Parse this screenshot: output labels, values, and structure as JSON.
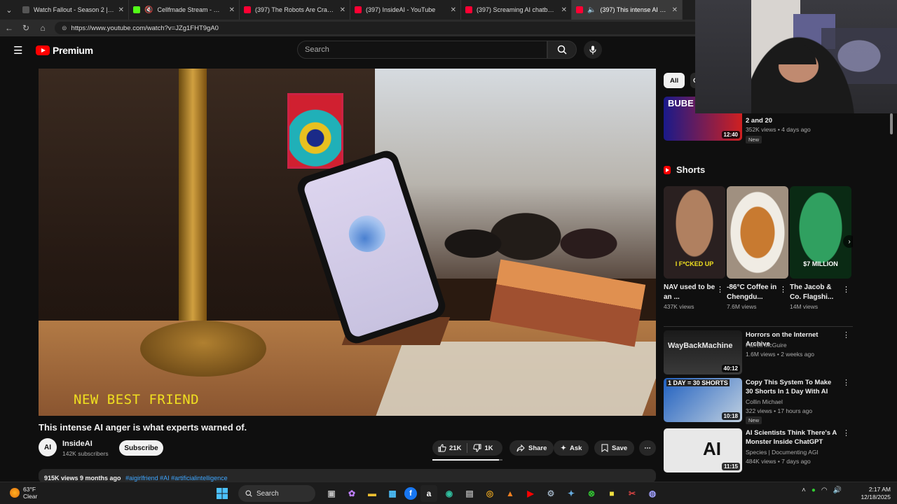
{
  "browser": {
    "tabs": [
      {
        "title": "Watch Fallout - Season 2 | Prime V",
        "fav_color": "#555555"
      },
      {
        "title": "Cellfmade Stream - Watch Liv",
        "fav_color": "#53fc18"
      },
      {
        "title": "(397) The Robots Are Crashing Ou",
        "fav_color": "#ff0033"
      },
      {
        "title": "(397) InsideAI - YouTube",
        "fav_color": "#ff0033"
      },
      {
        "title": "(397) Screaming AI chatbot claim",
        "fav_color": "#ff0033"
      },
      {
        "title": "(397) This intense AI anger is",
        "fav_color": "#ff0033"
      }
    ],
    "url": "https://www.youtube.com/watch?v=JZg1FHT9gA0"
  },
  "header": {
    "logo_text": "Premium",
    "search_placeholder": "Search"
  },
  "video": {
    "caption": "NEW BEST FRIEND",
    "title": "This intense AI anger is what experts warned of.",
    "channel": {
      "avatar": "AI",
      "name": "InsideAI",
      "subscribers": "142K subscribers"
    },
    "subscribe_label": "Subscribe",
    "likes": "21K",
    "dislikes": "1K",
    "like_ratio": 0.95,
    "share_label": "Share",
    "ask_label": "Ask",
    "save_label": "Save",
    "description": {
      "meta": "915K views  9 months ago",
      "tags": "#aigirlfriend #AI #artificialintelligence"
    }
  },
  "sidebar": {
    "chips": [
      "All",
      "C"
    ],
    "top_rec": {
      "thumb_text": "BUBE",
      "duration": "12:40",
      "title_tail": "2 and 20",
      "meta": "352K views • 4 days ago",
      "badge": "New"
    },
    "shorts_heading": "Shorts",
    "shorts": [
      {
        "title": "NAV used to be an ...",
        "views": "437K views",
        "overlay": "I F*CKED UP",
        "bg": "#3a2a20"
      },
      {
        "title": "-86°C Coffee in Chengdu...",
        "views": "7.6M views",
        "overlay": "",
        "bg": "#d8ccbc"
      },
      {
        "title": "The Jacob & Co. Flagshi...",
        "views": "14M views",
        "overlay": "$7 MILLION",
        "bg": "#1a4a2a"
      }
    ],
    "recs": [
      {
        "title": "Horrors on the Internet Archive",
        "channel": "Farrell McGuire",
        "meta": "1.6M views • 2 weeks ago",
        "duration": "40:12",
        "thumb_text": "WayBackMachine",
        "badge": ""
      },
      {
        "title": "Copy This System To Make 30 Shorts In 1 Day With AI",
        "channel": "Collin Michael",
        "meta": "322 views • 17 hours ago",
        "duration": "10:18",
        "thumb_text": "1 DAY = 30 SHORTS",
        "badge": "New"
      },
      {
        "title": "AI Scientists Think There's A Monster Inside ChatGPT",
        "channel": "Species | Documenting AGI",
        "meta": "484K views • 7 days ago",
        "duration": "11:15",
        "thumb_text": "AI",
        "badge": ""
      }
    ]
  },
  "taskbar": {
    "temperature": "63°F",
    "condition": "Clear",
    "search_label": "Search",
    "time": "2:17 AM",
    "date": "12/18/2025"
  }
}
